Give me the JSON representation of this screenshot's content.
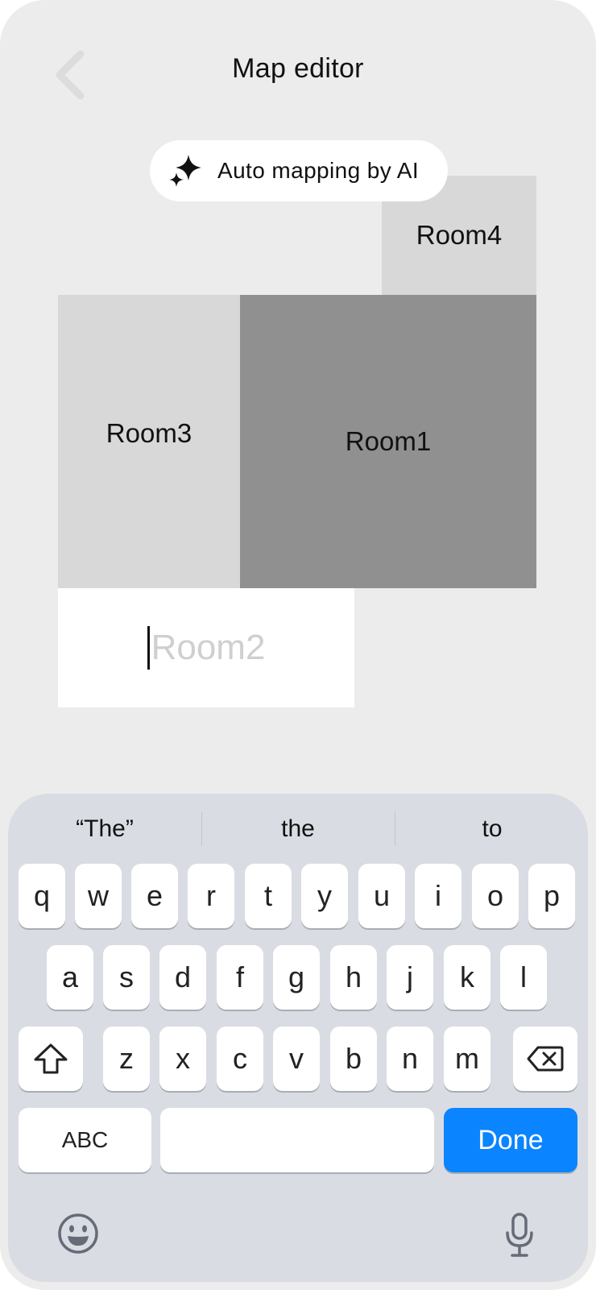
{
  "header": {
    "title": "Map editor",
    "back_icon": "chevron-left-icon"
  },
  "ai_button": {
    "label": "Auto mapping by AI",
    "icon": "sparkle-icon"
  },
  "rooms": {
    "room1": "Room1",
    "room2_placeholder": "Room2",
    "room3": "Room3",
    "room4": "Room4"
  },
  "colors": {
    "background": "#ececec",
    "room_light": "#d8d8d8",
    "room_selected": "#909090",
    "room_editing": "#ffffff",
    "accent": "#0a84ff"
  },
  "keyboard": {
    "suggestions": [
      "“The”",
      "the",
      "to"
    ],
    "row1": [
      "q",
      "w",
      "e",
      "r",
      "t",
      "y",
      "u",
      "i",
      "o",
      "p"
    ],
    "row2": [
      "a",
      "s",
      "d",
      "f",
      "g",
      "h",
      "j",
      "k",
      "l"
    ],
    "row3": [
      "z",
      "x",
      "c",
      "v",
      "b",
      "n",
      "m"
    ],
    "abc_label": "ABC",
    "done_label": "Done",
    "shift_icon": "shift-icon",
    "delete_icon": "backspace-icon",
    "emoji_icon": "emoji-icon",
    "mic_icon": "microphone-icon"
  }
}
